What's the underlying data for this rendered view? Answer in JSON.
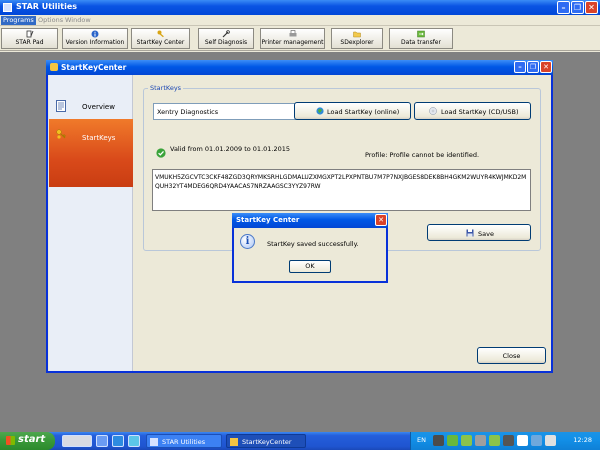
{
  "app": {
    "title": "STAR Utilities"
  },
  "menu": [
    "Programs",
    "Options",
    "Window"
  ],
  "toolbar": [
    {
      "label": "STAR Pad",
      "icon": "pen-icon"
    },
    {
      "label": "Version Information",
      "icon": "info-icon"
    },
    {
      "label": "StartKey Center",
      "icon": "key-icon"
    },
    {
      "label": "Self Diagnosis",
      "icon": "diagnosis-icon"
    },
    {
      "label": "Printer management",
      "icon": "printer-icon"
    },
    {
      "label": "SDexplorer",
      "icon": "folder-icon"
    },
    {
      "label": "Data transfer",
      "icon": "transfer-icon"
    }
  ],
  "skc": {
    "title": "StartKeyCenter",
    "nav": [
      {
        "label": "Overview",
        "icon": "document-icon"
      },
      {
        "label": "StartKeys",
        "icon": "keys-icon",
        "active": true
      }
    ],
    "group_label": "StartKeys",
    "product_value": "Xentry Diagnostics",
    "load_online": "Load StartKey (online)",
    "load_cd": "Load StartKey (CD/USB)",
    "valid_text": "Valid from 01.01.2009 to 01.01.2015",
    "profile_text": "Profile: Profile cannot be identified.",
    "key_text": "VMUKH5ZGCVTC3CKF48ZGD3QRYMKSRHLGDMALUZXMGXPT2LPXPNTBU7M7P7NXJBGES8DEK8BH4GKM2WUYR4KWJMKD2MQUH32YT4MDEG6QRD4YAACAS7NRZAAGSC3YYZ97RW",
    "save": "Save",
    "close": "Close"
  },
  "dialog": {
    "title": "StartKey Center",
    "message": "StartKey saved successfully.",
    "ok": "OK"
  },
  "taskbar": {
    "start": "start",
    "tasks": [
      "STAR Utilities",
      "StartKeyCenter"
    ],
    "lang": "EN",
    "clock": "12:28"
  },
  "colors": {
    "accent": "#0054e3",
    "nav_active": "#e05a1f",
    "taskbar": "#245edb"
  }
}
